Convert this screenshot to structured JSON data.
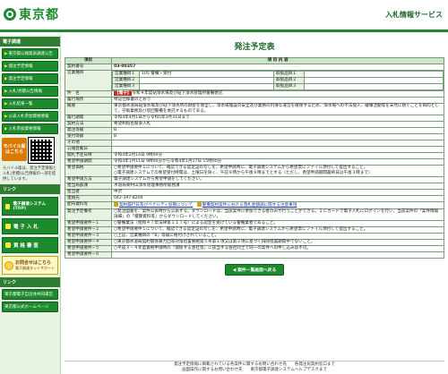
{
  "header": {
    "logo_text": "東京都",
    "service_title": "入札情報サービス"
  },
  "sidebar": {
    "section_main": "電子調達",
    "links": [
      "東京都公報発表調達公告",
      "発注予定情報",
      "発注予定情報",
      "入札/見積公告情報",
      "入札結果一覧",
      "公表入札参加資格情報",
      "入札参加資格情報"
    ],
    "mobile_badge": "モバイル版\nはこちら",
    "mobile_note": "モバイル版は、発注予定情報と入札(見積)公告情報の一部を提供しています。",
    "section_links": "リンク",
    "big_buttons": [
      "電子調達システム(TOP)",
      "電 子 入 札",
      "資 格 審 査"
    ],
    "helpdesk_title": "お問合せはこちら",
    "helpdesk_sub": "電子調達ネットサポート",
    "section_other": "リンク",
    "other_links": [
      "東京都電子自治体共同運営",
      "東京都公式ホームページ"
    ]
  },
  "main": {
    "page_title": "発注予定表",
    "header_item": "項目",
    "header_content": "項 目 内 容",
    "contract_no_label": "契約番号",
    "contract_no": "03-00357",
    "business_label": "営業種目",
    "business_1_label": "営業種目１",
    "business_1_value": "105 警備・受付",
    "business_2_label": "営業種目２",
    "business_3_label": "営業種目３",
    "handling_1": "取扱品目１",
    "handling_2": "取扱品目２",
    "handling_3": "取扱品目３",
    "subject_label": "件　名",
    "subject_tag": "【電子】",
    "subject_text": "令和４年度砧浄水場及び砧下浄水管理所警備委託",
    "fulfillment_label": "履行場所",
    "fulfillment": "特記仕様書のとおり",
    "summary_label": "概要",
    "summary": "東京都水道局砧浄水場及び砧下浄水所の財産を保全し、浄水場施設の安全及び業務の円滑な運営を確保するため、浄水場への不法侵入、破壊活動等を未然に防ぐことを目的として、守衛業務及び巡回警備を委託するものである。",
    "period_label": "履行期間",
    "period": "令和4年4月1日から令和5年3月31日まで",
    "method_label": "契約方法",
    "method": "希望制指名競争入札",
    "grade_label": "発注等級",
    "grade": "B",
    "receive_grade_label": "受付等級",
    "receive_grade": "B",
    "other_label": "その他",
    "other": "",
    "announce_label": "公報登載日",
    "announce": "",
    "open_label": "開札予定日時",
    "open": "令和4年2月14日 9時00分",
    "apply_period_label": "希望申請期間",
    "apply_period": "令和4年1月11日 9時00分から令和4年1月17日 15時00分",
    "apply_label": "希望価格",
    "apply_1": "○希望申請要件１について、確認できる認定証の写しを、希望申請時に、電子調達システムから希望票にファイル添付して提出すること。",
    "apply_2": "○電子調達システムでの希望受付時間は、土曜日を除く、午前９時から午後９時までとする（ただし、希望申請期間最終日は午後３時まで）",
    "apply_method_label": "希望申請方法",
    "apply_method": "電子調達システムから希望申請をしてください。",
    "office_label": "担当局部課",
    "office": "水道局東村山浄水管理事務所総務課",
    "person_label": "担当者",
    "person": "中沢",
    "tel_label": "連絡先",
    "tel": "042-397-8204",
    "docs_label": "配布資料等",
    "docs_link_1": "契約履行日及びペナルティ加算について",
    "docs_link_2": "警備契約案件における落札金額調に関する注意事項",
    "reason_label": "発注予定備考",
    "reason": "○発注図書を、案件公表時から公表する。ダウンロードは、当該案件に参加できる者のみが行うことができる。ＩＣカードで電子入札にログインを行い、当該案件の「案件情報詳細」の「積算資料等」からダウンロードしてください。",
    "req_1_label": "希望申請要件−１",
    "req_1": "○警備業法（昭和４７年法律第１１７号）による認定を受けている警備業者であること。",
    "req_2_label": "希望申請要件−２",
    "req_2": "○希望申請要件１について、確認できる認定証の写しを、希望申請時に、電子調達システムから希望票にファイル添付して提出すること。",
    "req_3_label": "希望申請要件−３",
    "req_3": "○上記、営業種目の「B」等級に格付けされていること。",
    "req_4_label": "希望申請要件−４",
    "req_4": "○東京都水道局契約関係暴力団等対策措置要綱第５条第１項又は第２項に基づく排除措置期間中でないこと。",
    "req_5_label": "希望申請要件−５",
    "req_5": "○平成３・４年度資格申請時の「関係する会社等」に該当する会社同士で同一の案件への申し込みは不可。",
    "req_6_label": "希望申請要件−６",
    "req_6": "",
    "back_button": "案件一覧画面へ戻る"
  },
  "footer": {
    "line1": "発注予定情報に掲載されている各案件に関するお問い合わせ先　　各発注局契約窓口まで",
    "line2": "画面操作に関するお問い合わせ先　　東京都電子調達システムヘルプデスクまで"
  },
  "colors": {
    "accent": "#1d8a2e",
    "header_bg": "#cfe3c9",
    "label_bg": "#e8f2e3"
  }
}
